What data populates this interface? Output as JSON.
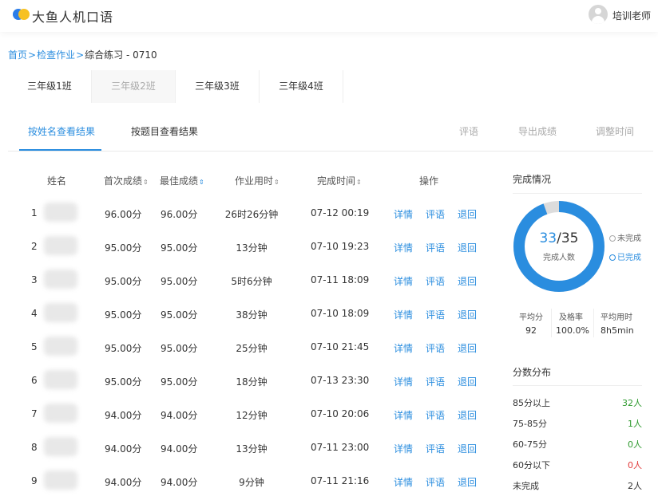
{
  "app": {
    "title": "大鱼人机口语"
  },
  "user": {
    "name": "培训老师"
  },
  "breadcrumb": {
    "home": "首页",
    "sep1": ">",
    "section": "检查作业",
    "sep2": ">",
    "current": "综合练习 - 0710"
  },
  "class_tabs": [
    {
      "label": "三年级1班",
      "state": "normal"
    },
    {
      "label": "三年级2班",
      "state": "disabled"
    },
    {
      "label": "三年级3班",
      "state": "normal"
    },
    {
      "label": "三年级4班",
      "state": "normal"
    }
  ],
  "view_tabs": {
    "by_name": "按姓名查看结果",
    "by_question": "按题目查看结果"
  },
  "actions": {
    "comment": "评语",
    "export": "导出成绩",
    "adjust_time": "调整时间"
  },
  "table": {
    "headers": {
      "name": "姓名",
      "first_score": "首次成绩",
      "best_score": "最佳成绩",
      "duration": "作业用时",
      "finish_time": "完成时间",
      "operation": "操作"
    },
    "sort_icon": "⇕",
    "op_labels": {
      "detail": "详情",
      "comment": "评语",
      "return": "退回"
    },
    "rows": [
      {
        "index": "1",
        "first": "96.00分",
        "best": "96.00分",
        "duration": "26时26分钟",
        "finish": "07-12 00:19"
      },
      {
        "index": "2",
        "first": "95.00分",
        "best": "95.00分",
        "duration": "13分钟",
        "finish": "07-10 19:23"
      },
      {
        "index": "3",
        "first": "95.00分",
        "best": "95.00分",
        "duration": "5时6分钟",
        "finish": "07-11 18:09"
      },
      {
        "index": "4",
        "first": "95.00分",
        "best": "95.00分",
        "duration": "38分钟",
        "finish": "07-10 18:09"
      },
      {
        "index": "5",
        "first": "95.00分",
        "best": "95.00分",
        "duration": "25分钟",
        "finish": "07-10 21:45"
      },
      {
        "index": "6",
        "first": "95.00分",
        "best": "95.00分",
        "duration": "18分钟",
        "finish": "07-13 23:30"
      },
      {
        "index": "7",
        "first": "94.00分",
        "best": "94.00分",
        "duration": "12分钟",
        "finish": "07-10 20:06"
      },
      {
        "index": "8",
        "first": "94.00分",
        "best": "94.00分",
        "duration": "13分钟",
        "finish": "07-11 23:00"
      },
      {
        "index": "9",
        "first": "94.00分",
        "best": "94.00分",
        "duration": "9分钟",
        "finish": "07-11 21:16"
      }
    ]
  },
  "completion": {
    "title": "完成情况",
    "completed": "33",
    "slash": "/",
    "total": "35",
    "caption": "完成人数",
    "legend_incomplete": "未完成",
    "legend_complete": "已完成",
    "completed_fraction": 0.943,
    "stats": {
      "avg_label": "平均分",
      "avg_value": "92",
      "pass_label": "及格率",
      "pass_value": "100.0%",
      "time_label": "平均用时",
      "time_value": "8h5min"
    }
  },
  "distribution": {
    "title": "分数分布",
    "rows": [
      {
        "label": "85分以上",
        "value": "32人",
        "color": "#2e9a2e"
      },
      {
        "label": "75-85分",
        "value": "1人",
        "color": "#2e9a2e"
      },
      {
        "label": "60-75分",
        "value": "0人",
        "color": "#2e9a2e"
      },
      {
        "label": "60分以下",
        "value": "0人",
        "color": "#e23b3b"
      },
      {
        "label": "未完成",
        "value": "2人",
        "color": "#333333"
      }
    ]
  },
  "colors": {
    "accent": "#2a8ddf",
    "ring_complete": "#2a8ddf",
    "ring_incomplete": "#dcdcdc"
  }
}
